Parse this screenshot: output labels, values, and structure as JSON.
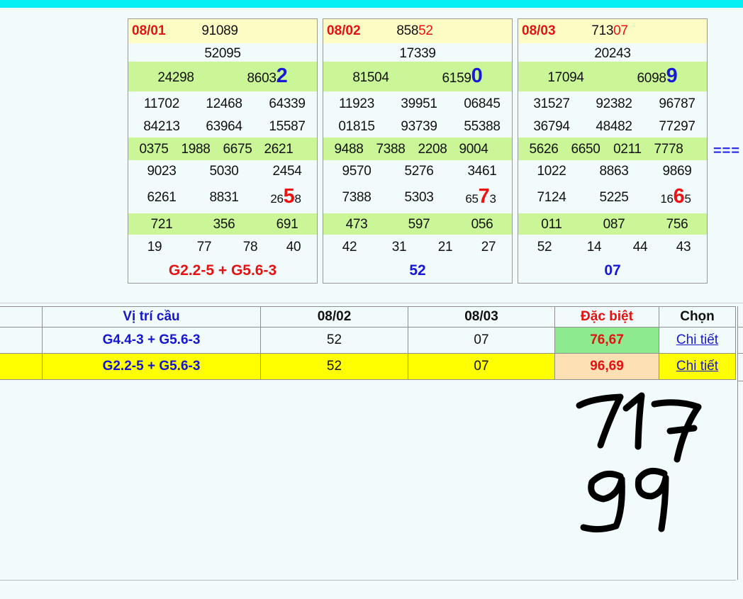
{
  "panels": [
    {
      "date": "08/01",
      "header_black": "91089",
      "header_red": "",
      "g1": "52095",
      "g2a": "24298",
      "g2b_small": "8603",
      "g2b_big": "2",
      "g3": [
        "11702",
        "12468",
        "64339",
        "84213",
        "63964",
        "15587"
      ],
      "g4": [
        "0375",
        "1988",
        "6675",
        "2621"
      ],
      "g5": [
        "9023",
        "5030",
        "2454",
        "6261",
        "8831"
      ],
      "g5last_a": "26",
      "g5last_big": "5",
      "g5last_b": "8",
      "g6": [
        "721",
        "356",
        "691"
      ],
      "g7": [
        "19",
        "77",
        "78",
        "40"
      ],
      "footer": "G2.2-5 + G5.6-3",
      "footer_color": "#e41212"
    },
    {
      "date": "08/02",
      "header_black": "858",
      "header_red": "52",
      "g1": "17339",
      "g2a": "81504",
      "g2b_small": "6159",
      "g2b_big": "0",
      "g3": [
        "11923",
        "39951",
        "06845",
        "01815",
        "93739",
        "55388"
      ],
      "g4": [
        "9488",
        "7388",
        "2208",
        "9004"
      ],
      "g5": [
        "9570",
        "5276",
        "3461",
        "7388",
        "5303"
      ],
      "g5last_a": "65",
      "g5last_big": "7",
      "g5last_b": "3",
      "g6": [
        "473",
        "597",
        "056"
      ],
      "g7": [
        "42",
        "31",
        "21",
        "27"
      ],
      "footer": "52",
      "footer_color": "#1717d8"
    },
    {
      "date": "08/03",
      "header_black": "713",
      "header_red": "07",
      "g1": "20243",
      "g2a": "17094",
      "g2b_small": "6098",
      "g2b_big": "9",
      "g3": [
        "31527",
        "92382",
        "96787",
        "36794",
        "48482",
        "77297"
      ],
      "g4": [
        "5626",
        "6650",
        "0211",
        "7778"
      ],
      "g5": [
        "1022",
        "8863",
        "9869",
        "7124",
        "5225"
      ],
      "g5last_a": "16",
      "g5last_big": "6",
      "g5last_b": "5",
      "g6": [
        "011",
        "087",
        "756"
      ],
      "g7": [
        "52",
        "14",
        "44",
        "43"
      ],
      "footer": "07",
      "footer_color": "#1717d8"
    }
  ],
  "arrow_text": "===",
  "table": {
    "headers": {
      "position": "Vị trí cầu",
      "d1": "08/02",
      "d2": "08/03",
      "special": "Đặc biệt",
      "choose": "Chọn"
    },
    "rows": [
      {
        "bridge": "G4.4-3 + G5.6-3",
        "d1": "52",
        "d2": "07",
        "special": "76,67",
        "link": "Chi tiết",
        "special_bg": "#8eea8e"
      },
      {
        "bridge": "G2.2-5 + G5.6-3",
        "d1": "52",
        "d2": "07",
        "special": "96,69",
        "link": "Chi tiết",
        "special_bg": "#fde0b4",
        "highlight": "#ffff00"
      }
    ]
  },
  "handwriting": [
    "717",
    "99"
  ]
}
